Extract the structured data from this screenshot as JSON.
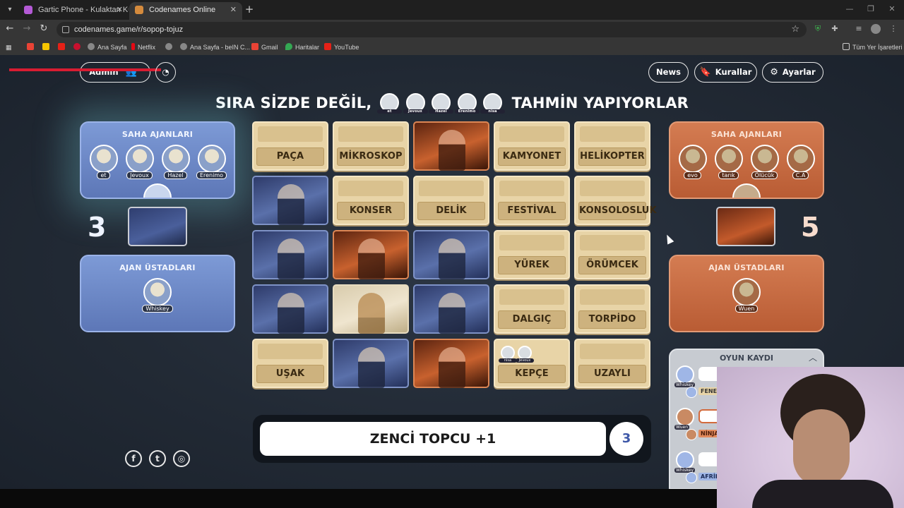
{
  "browser": {
    "tabs": [
      {
        "title": "Gartic Phone - Kulaktan Kulağa",
        "active": false,
        "favicon_color": "#b45ad6"
      },
      {
        "title": "Codenames Online",
        "active": true,
        "favicon_color": "#d58b3d"
      }
    ],
    "url": "codenames.game/r/sopop-tojuz",
    "bookmarks": [
      {
        "label": "",
        "icon_color": "#ea4335"
      },
      {
        "label": "",
        "icon_color": "#f7c600"
      },
      {
        "label": "",
        "icon_color": "#e62117"
      },
      {
        "label": "",
        "icon_color": "#c8102e"
      },
      {
        "label": "Ana Sayfa",
        "icon_color": "#888888"
      },
      {
        "label": "Netflix",
        "icon_color": "#e50914"
      },
      {
        "label": "",
        "icon_color": "#888888"
      },
      {
        "label": "Ana Sayfa - beIN C...",
        "icon_color": "#888888"
      },
      {
        "label": "Gmail",
        "icon_color": "#ea4335"
      },
      {
        "label": "Haritalar",
        "icon_color": "#34a853"
      },
      {
        "label": "YouTube",
        "icon_color": "#e62117"
      }
    ],
    "all_bookmarks": "Tüm Yer İşaretleri"
  },
  "header": {
    "admin_label": "Admin",
    "news_label": "News",
    "rules_label": "Kurallar",
    "settings_label": "Ayarlar"
  },
  "headline": {
    "prefix": "SIRA SİZDE DEĞİL,",
    "suffix": "TAHMİN YAPIYORLAR",
    "guessers": [
      "et",
      "Jevoux",
      "Hazel",
      "Erenimo",
      "nisa"
    ]
  },
  "blue_team": {
    "operatives_title": "SAHA AJANLARI",
    "operatives": [
      "et",
      "Jevoux",
      "Hazel",
      "Erenimo"
    ],
    "spymasters_title": "AJAN ÜSTADLARI",
    "spymasters": [
      "Whiskey"
    ],
    "score": "3",
    "color": "#6f8ac9"
  },
  "red_team": {
    "operatives_title": "SAHA AJANLARI",
    "operatives": [
      "evo",
      "tarık",
      "Ölücük",
      "C.A"
    ],
    "spymasters_title": "AJAN ÜSTADLARI",
    "spymasters": [
      "Wuen"
    ],
    "score": "5",
    "color": "#c86a3e"
  },
  "board": [
    {
      "type": "word",
      "word": "PAÇA"
    },
    {
      "type": "word",
      "word": "MİKROSKOP"
    },
    {
      "type": "red"
    },
    {
      "type": "word",
      "word": "KAMYONET"
    },
    {
      "type": "word",
      "word": "HELİKOPTER"
    },
    {
      "type": "blue"
    },
    {
      "type": "word",
      "word": "KONSER"
    },
    {
      "type": "word",
      "word": "DELİK"
    },
    {
      "type": "word",
      "word": "FESTİVAL"
    },
    {
      "type": "word",
      "word": "KONSOLOSLUK"
    },
    {
      "type": "blue"
    },
    {
      "type": "red"
    },
    {
      "type": "blue"
    },
    {
      "type": "word",
      "word": "YÜREK"
    },
    {
      "type": "word",
      "word": "ÖRÜMCEK"
    },
    {
      "type": "blue"
    },
    {
      "type": "bystander"
    },
    {
      "type": "blue"
    },
    {
      "type": "word",
      "word": "DALGIÇ"
    },
    {
      "type": "word",
      "word": "TORPİDO"
    },
    {
      "type": "word",
      "word": "UŞAK"
    },
    {
      "type": "blue"
    },
    {
      "type": "red"
    },
    {
      "type": "word",
      "word": "KEPÇE",
      "voters": [
        "nisa",
        "Jevoux"
      ]
    },
    {
      "type": "word",
      "word": "UZAYLI"
    }
  ],
  "clue": {
    "text": "ZENCİ TOPCU +1",
    "count": "3"
  },
  "game_log": {
    "title": "OYUN KAYDI",
    "entries": [
      {
        "spymaster": "Whiskey",
        "team": "blue",
        "guess": "FENER",
        "guess_type": "word"
      },
      {
        "spymaster": "Wuen",
        "team": "red",
        "guesser": "C.A",
        "guess": "NİNJA",
        "guess_type": "red"
      },
      {
        "spymaster": "Whiskey",
        "team": "blue",
        "guess": "AFRİKA",
        "guess_type": "blue"
      }
    ]
  }
}
